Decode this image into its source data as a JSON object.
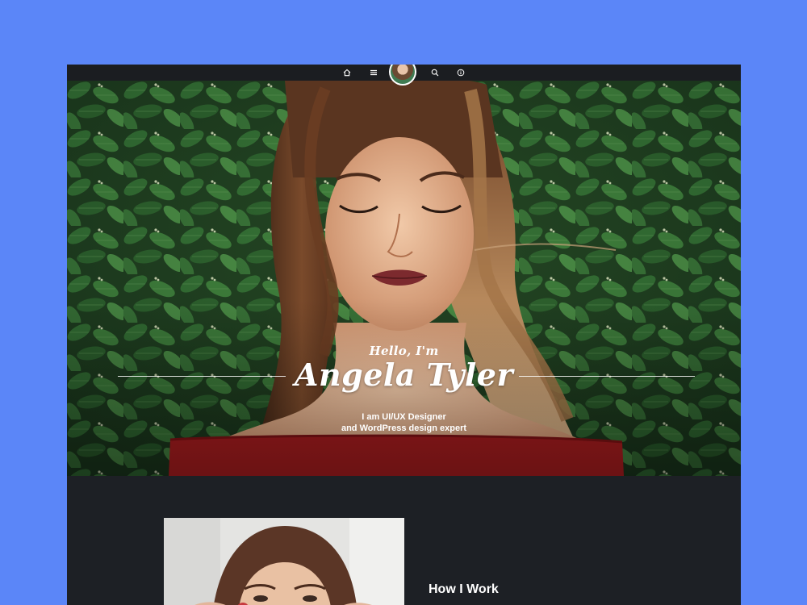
{
  "nav": {
    "items": [
      {
        "icon": "home-icon"
      },
      {
        "icon": "menu-icon"
      },
      {
        "icon": "avatar"
      },
      {
        "icon": "search-icon"
      },
      {
        "icon": "info-icon"
      }
    ]
  },
  "hero": {
    "greeting": "Hello, I'm",
    "name": "Angela Tyler",
    "tagline_line1": "I am UI/UX Designer",
    "tagline_line2": "and WordPress design expert"
  },
  "about": {
    "heading": "How I Work"
  },
  "colors": {
    "page_background": "#5b86f8",
    "site_background": "#1d2025",
    "nav_background": "#1b1d21",
    "text": "#ffffff",
    "foliage": "#2f5a2f",
    "dress": "#a51c1e"
  }
}
